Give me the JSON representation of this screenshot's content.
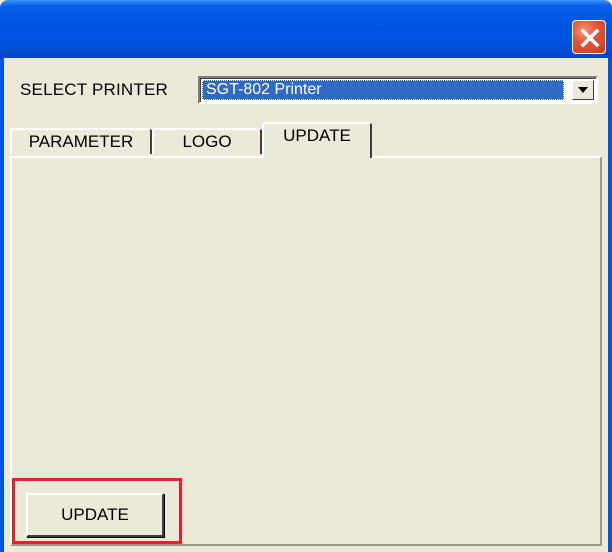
{
  "window": {
    "title": "",
    "close_icon": "close-x-icon",
    "close_color": "#d9482a"
  },
  "printer_select": {
    "label": "SELECT PRINTER",
    "value": "SGT-802 Printer",
    "dropdown_icon": "chevron-down-icon"
  },
  "tabs": [
    {
      "label": "PARAMETER",
      "active": false
    },
    {
      "label": "LOGO",
      "active": false
    },
    {
      "label": "UPDATE",
      "active": true
    }
  ],
  "update_pane": {
    "button_label": "UPDATE"
  },
  "annotation": {
    "highlight_color": "#e8202a"
  }
}
